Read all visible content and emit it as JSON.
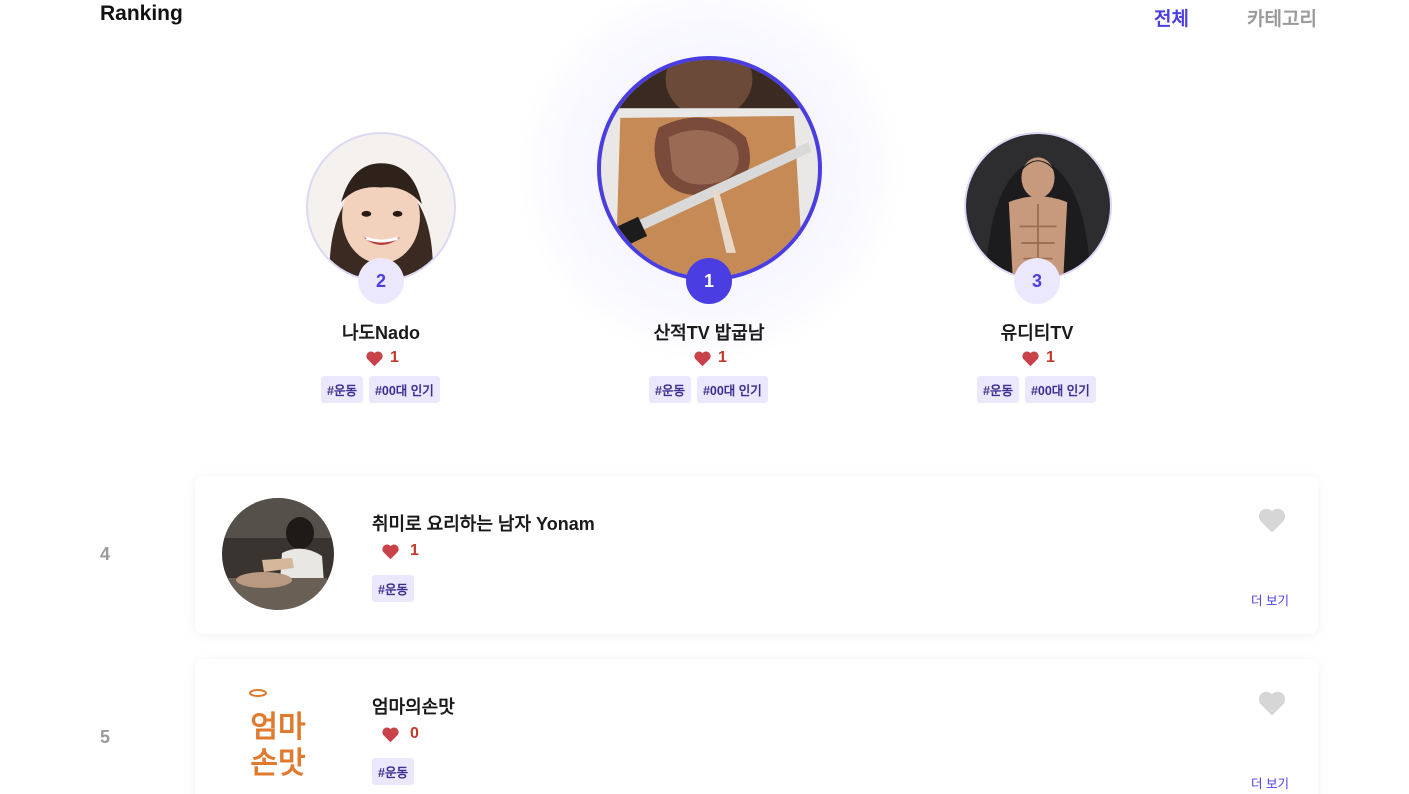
{
  "header": {
    "title": "Ranking",
    "tabs": [
      {
        "label": "전체",
        "active": true
      },
      {
        "label": "카테고리",
        "active": false
      }
    ]
  },
  "colors": {
    "accent": "#4a3ee3",
    "accent_light": "#ebe8fd",
    "heart": "#c9424a",
    "muted": "#9a9a9a"
  },
  "podium": [
    {
      "rank": "2",
      "name": "나도Nado",
      "likes": "1",
      "tags": [
        "#운동",
        "#00대 인기"
      ]
    },
    {
      "rank": "1",
      "name": "산적TV 밥굽남",
      "likes": "1",
      "tags": [
        "#운동",
        "#00대 인기"
      ]
    },
    {
      "rank": "3",
      "name": "유디티TV",
      "likes": "1",
      "tags": [
        "#운동",
        "#00대 인기"
      ]
    }
  ],
  "list": [
    {
      "rank": "4",
      "name": "취미로 요리하는 남자 Yonam",
      "likes": "1",
      "tags": [
        "#운동"
      ],
      "more_label": "더 보기",
      "favorite_icon": "heart-outline-icon"
    },
    {
      "rank": "5",
      "name": "엄마의손맛",
      "likes": "0",
      "tags": [
        "#운동"
      ],
      "more_label": "더 보기",
      "favorite_icon": "heart-outline-icon",
      "logo_text": "엄마 손맛"
    }
  ]
}
